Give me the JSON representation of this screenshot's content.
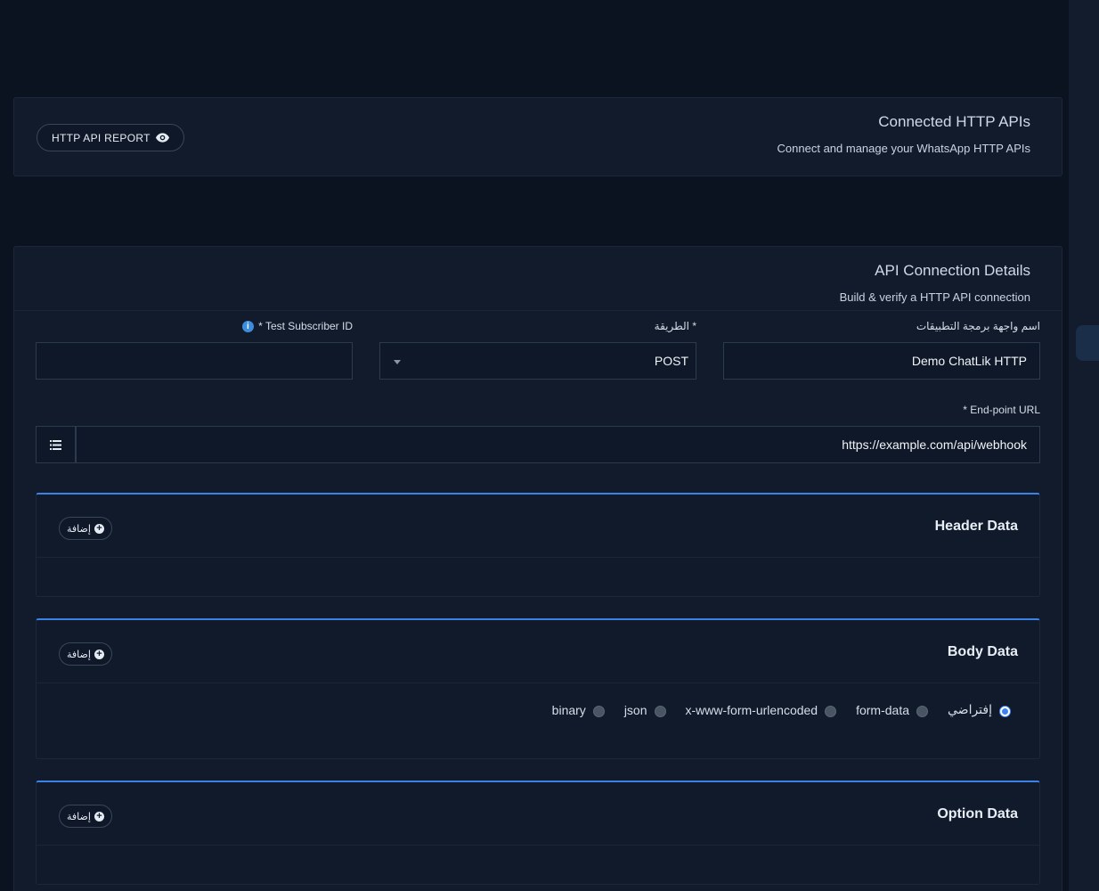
{
  "connected_card": {
    "title": "Connected HTTP APIs",
    "subtitle": "Connect and manage your WhatsApp HTTP APIs",
    "report_button": "HTTP API REPORT"
  },
  "details_card": {
    "title": "API Connection Details",
    "subtitle": "Build & verify a HTTP API connection"
  },
  "form": {
    "api_name_label": "اسم واجهة برمجة التطبيقات",
    "api_name_value": "Demo ChatLik HTTP",
    "method_label": "الطريقة *",
    "method_value": "POST",
    "subscriber_label": "* Test Subscriber ID",
    "subscriber_value": "",
    "endpoint_label": "* End-point URL",
    "endpoint_value": "https://example.com/api/webhook"
  },
  "sections": {
    "header": {
      "title": "Header Data",
      "add_label": "إضافة"
    },
    "body": {
      "title": "Body Data",
      "add_label": "إضافة",
      "options": [
        "إفتراضي",
        "form-data",
        "x-www-form-urlencoded",
        "json",
        "binary"
      ],
      "selected": "إفتراضي"
    },
    "option": {
      "title": "Option Data",
      "add_label": "إضافة"
    }
  },
  "icons": {
    "eye": "eye-icon",
    "info": "info-icon",
    "list": "list-icon",
    "plus": "plus-circle-icon",
    "caret": "caret-down-icon"
  },
  "colors": {
    "accent": "#3c82e6",
    "background": "#0c1320",
    "card": "#111b2c"
  }
}
